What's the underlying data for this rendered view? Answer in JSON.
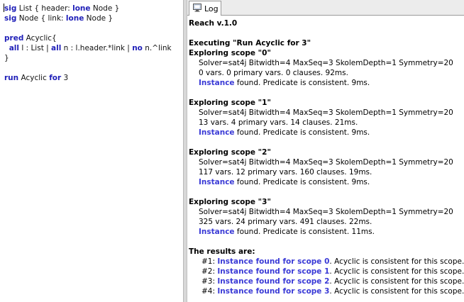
{
  "editor": {
    "lines": [
      [
        {
          "t": "sig",
          "k": true
        },
        {
          "t": " List { header: "
        },
        {
          "t": "lone",
          "k": true
        },
        {
          "t": " Node }"
        }
      ],
      [
        {
          "t": "sig",
          "k": true
        },
        {
          "t": " Node { link: "
        },
        {
          "t": "lone",
          "k": true
        },
        {
          "t": " Node }"
        }
      ],
      [],
      [
        {
          "t": "pred",
          "k": true
        },
        {
          "t": " Acyclic{"
        }
      ],
      [
        {
          "t": "  "
        },
        {
          "t": "all",
          "k": true
        },
        {
          "t": " l : List | "
        },
        {
          "t": "all",
          "k": true
        },
        {
          "t": " n : l.header.*link | "
        },
        {
          "t": "no",
          "k": true
        },
        {
          "t": " n.^link"
        }
      ],
      [
        {
          "t": "}"
        }
      ],
      [],
      [
        {
          "t": "run",
          "k": true
        },
        {
          "t": " Acyclic "
        },
        {
          "t": "for",
          "k": true
        },
        {
          "t": " 3"
        }
      ]
    ]
  },
  "log_tab": {
    "label": "Log"
  },
  "log": {
    "version": "Reach v.1.0",
    "executing": "Executing \"Run Acyclic for 3\"",
    "scopes": [
      {
        "title": "Exploring scope \"0\"",
        "solver": "Solver=sat4j Bitwidth=4 MaxSeq=3 SkolemDepth=1 Symmetry=20",
        "stats": "0 vars. 0 primary vars. 0 clauses. 92ms.",
        "instance": "Instance",
        "result": " found. Predicate is consistent. 9ms."
      },
      {
        "title": "Exploring scope \"1\"",
        "solver": "Solver=sat4j Bitwidth=4 MaxSeq=3 SkolemDepth=1 Symmetry=20",
        "stats": "13 vars. 4 primary vars. 14 clauses. 21ms.",
        "instance": "Instance",
        "result": " found. Predicate is consistent. 9ms."
      },
      {
        "title": "Exploring scope \"2\"",
        "solver": "Solver=sat4j Bitwidth=4 MaxSeq=3 SkolemDepth=1 Symmetry=20",
        "stats": "117 vars. 12 primary vars. 160 clauses. 19ms.",
        "instance": "Instance",
        "result": " found. Predicate is consistent. 9ms."
      },
      {
        "title": "Exploring scope \"3\"",
        "solver": "Solver=sat4j Bitwidth=4 MaxSeq=3 SkolemDepth=1 Symmetry=20",
        "stats": "325 vars. 24 primary vars. 491 clauses. 22ms.",
        "instance": "Instance",
        "result": " found. Predicate is consistent. 11ms."
      }
    ],
    "results_header": "The results are:",
    "results": [
      {
        "num": "#1: ",
        "link": "Instance found for scope 0",
        "text": ". Acyclic is consistent for this scope."
      },
      {
        "num": "#2: ",
        "link": "Instance found for scope 1",
        "text": ". Acyclic is consistent for this scope."
      },
      {
        "num": "#3: ",
        "link": "Instance found for scope 2",
        "text": ". Acyclic is consistent for this scope."
      },
      {
        "num": "#4: ",
        "link": "Instance found for scope 3",
        "text": ". Acyclic is consistent for this scope."
      }
    ]
  },
  "colors": {
    "keyword": "#1f1fb8",
    "link": "#3a3ad6"
  },
  "icons": {
    "log_tab": "monitor-icon"
  }
}
